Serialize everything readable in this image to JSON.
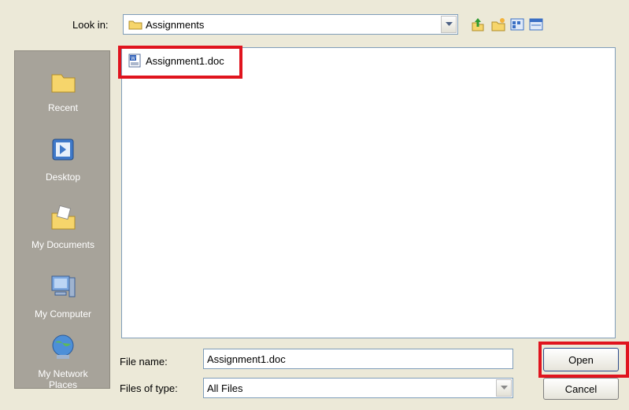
{
  "look_in": {
    "label": "Look in:",
    "value": "Assignments"
  },
  "toolbar": {
    "icons": [
      "up-one-level-icon",
      "new-folder-icon",
      "view-menu-icon",
      "details-view-icon"
    ]
  },
  "places": [
    {
      "label": "Recent",
      "icon": "recent-folder-icon"
    },
    {
      "label": "Desktop",
      "icon": "desktop-icon"
    },
    {
      "label": "My Documents",
      "icon": "my-documents-icon"
    },
    {
      "label": "My Computer",
      "icon": "my-computer-icon"
    },
    {
      "label_line1": "My Network",
      "label_line2": "Places",
      "icon": "network-places-icon"
    }
  ],
  "files": [
    {
      "name": "Assignment1.doc",
      "icon": "word-document-icon",
      "highlighted": true
    }
  ],
  "file_name": {
    "label": "File name:",
    "value": "Assignment1.doc"
  },
  "file_type": {
    "label": "Files of type:",
    "value": "All Files"
  },
  "buttons": {
    "open": "Open",
    "cancel": "Cancel"
  },
  "colors": {
    "highlight": "#e0141e",
    "places_bg": "#a7a39a",
    "dialog_bg": "#ece9d8",
    "border_blue": "#7f9db9"
  }
}
